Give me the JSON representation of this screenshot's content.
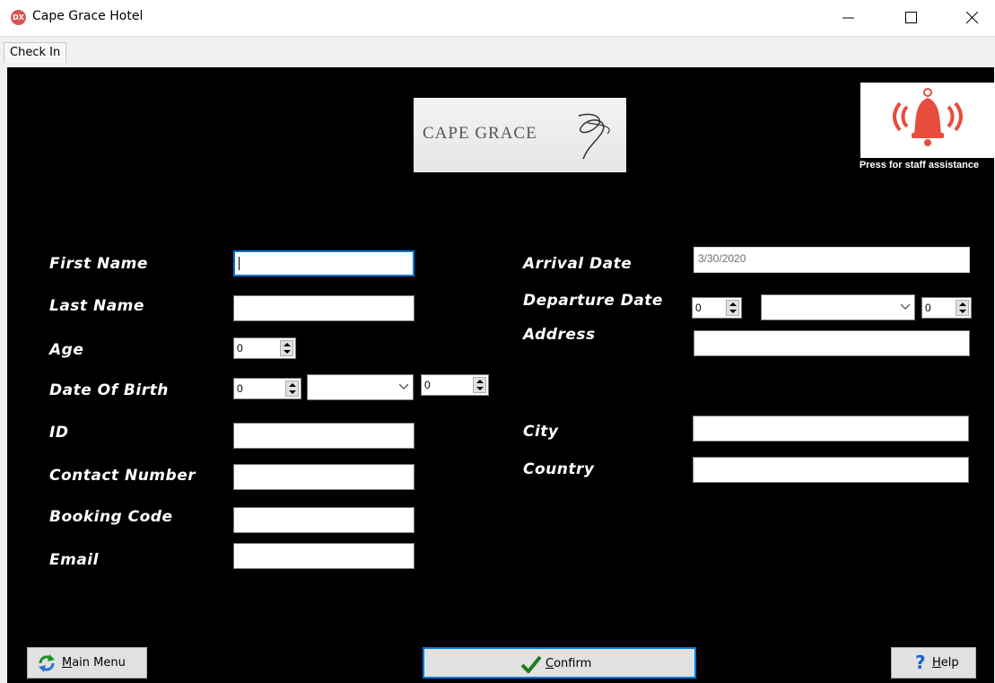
{
  "window": {
    "title": "Cape Grace Hotel",
    "icon_text": "DX"
  },
  "tabs": [
    {
      "label": "Check In"
    }
  ],
  "logo": {
    "text": "CAPE GRACE"
  },
  "assistance": {
    "caption": "Press for staff assistance"
  },
  "form_left": {
    "first_name": {
      "label": "First Name",
      "value": ""
    },
    "last_name": {
      "label": "Last Name",
      "value": ""
    },
    "age": {
      "label": "Age",
      "value": "0"
    },
    "dob": {
      "label": "Date Of Birth",
      "day": "0",
      "month": "",
      "year": "0"
    },
    "id": {
      "label": "ID",
      "value": ""
    },
    "contact": {
      "label": "Contact Number",
      "value": ""
    },
    "booking": {
      "label": "Booking Code",
      "value": ""
    },
    "email": {
      "label": "Email",
      "value": ""
    }
  },
  "form_right": {
    "arrival": {
      "label": "Arrival Date",
      "value": "3/30/2020"
    },
    "departure": {
      "label": "Departure Date",
      "day": "0",
      "month": "",
      "year": "0"
    },
    "address": {
      "label": "Address",
      "value": ""
    },
    "city": {
      "label": "City",
      "value": ""
    },
    "country": {
      "label": "Country",
      "value": ""
    }
  },
  "buttons": {
    "main_menu": {
      "first": "M",
      "rest": "ain Menu"
    },
    "confirm": {
      "first": "C",
      "rest": "onfirm"
    },
    "help": {
      "first": "H",
      "rest": "elp"
    }
  },
  "colors": {
    "background": "#000000",
    "accent": "#0078d7",
    "bell": "#e74c3c",
    "confirm_check": "#1e7b1e"
  }
}
